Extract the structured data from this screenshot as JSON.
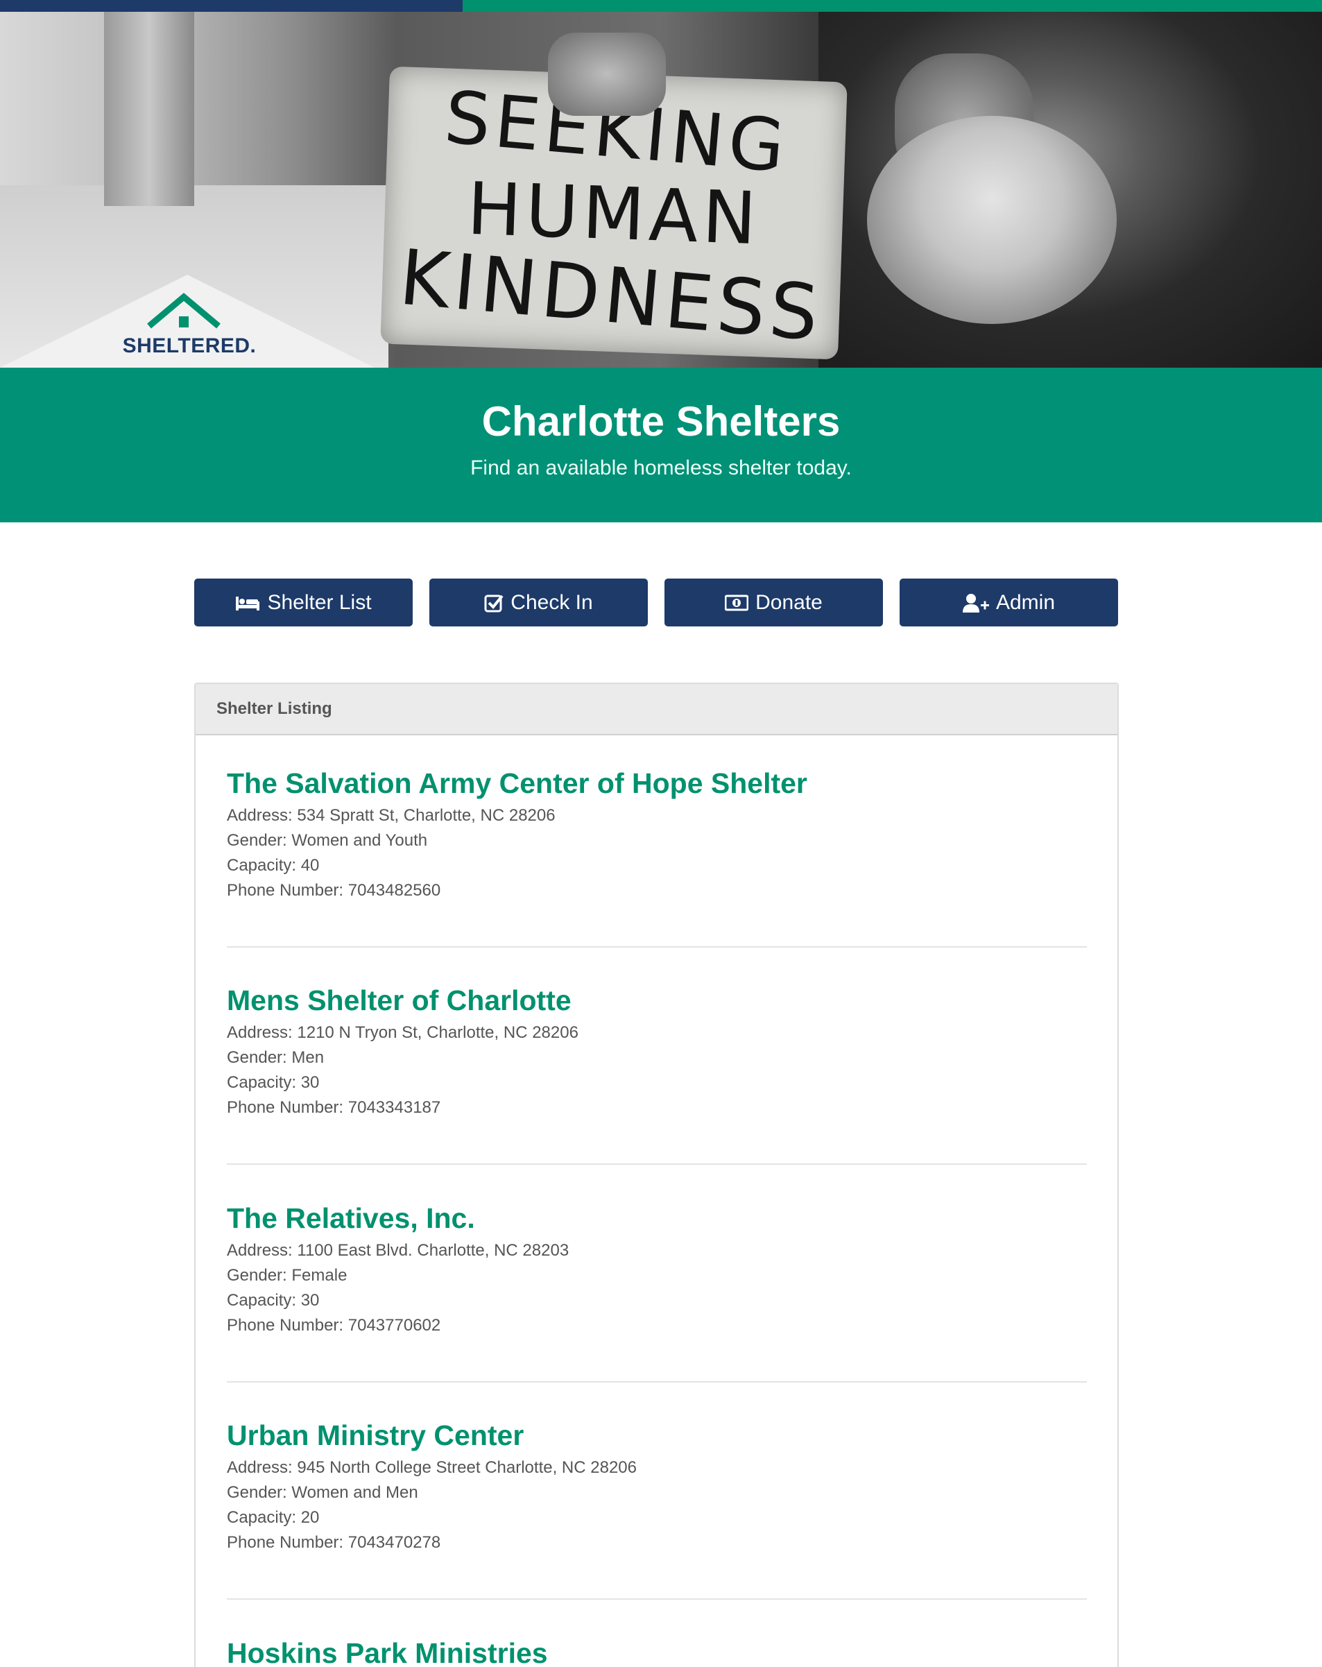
{
  "hero": {
    "sign_lines": [
      "SEEKING",
      "HUMAN",
      "KINDNESS"
    ],
    "logo_text": "SHELTERED."
  },
  "banner": {
    "title": "Charlotte Shelters",
    "subtitle": "Find an available homeless shelter today."
  },
  "nav": [
    {
      "label": "Shelter List",
      "icon": "bed-icon"
    },
    {
      "label": "Check In",
      "icon": "check-square-icon"
    },
    {
      "label": "Donate",
      "icon": "money-bill-icon"
    },
    {
      "label": "Admin",
      "icon": "user-plus-icon"
    }
  ],
  "panel": {
    "heading": "Shelter Listing"
  },
  "shelters": [
    {
      "name": "The Salvation Army Center of Hope Shelter",
      "address": "Address: 534 Spratt St, Charlotte, NC 28206",
      "gender": "Gender: Women and Youth",
      "capacity": "Capacity: 40",
      "phone": "Phone Number: 7043482560"
    },
    {
      "name": "Mens Shelter of Charlotte",
      "address": "Address: 1210 N Tryon St, Charlotte, NC 28206",
      "gender": "Gender: Men",
      "capacity": "Capacity: 30",
      "phone": "Phone Number: 7043343187"
    },
    {
      "name": "The Relatives, Inc.",
      "address": "Address: 1100 East Blvd. Charlotte, NC 28203",
      "gender": "Gender: Female",
      "capacity": "Capacity: 30",
      "phone": "Phone Number: 7043770602"
    },
    {
      "name": "Urban Ministry Center",
      "address": "Address: 945 North College Street Charlotte, NC 28206",
      "gender": "Gender: Women and Men",
      "capacity": "Capacity: 20",
      "phone": "Phone Number: 7043470278"
    },
    {
      "name": "Hoskins Park Ministries"
    }
  ],
  "colors": {
    "navy": "#1d3a68",
    "green": "#00916e",
    "banner_green": "#009176"
  }
}
